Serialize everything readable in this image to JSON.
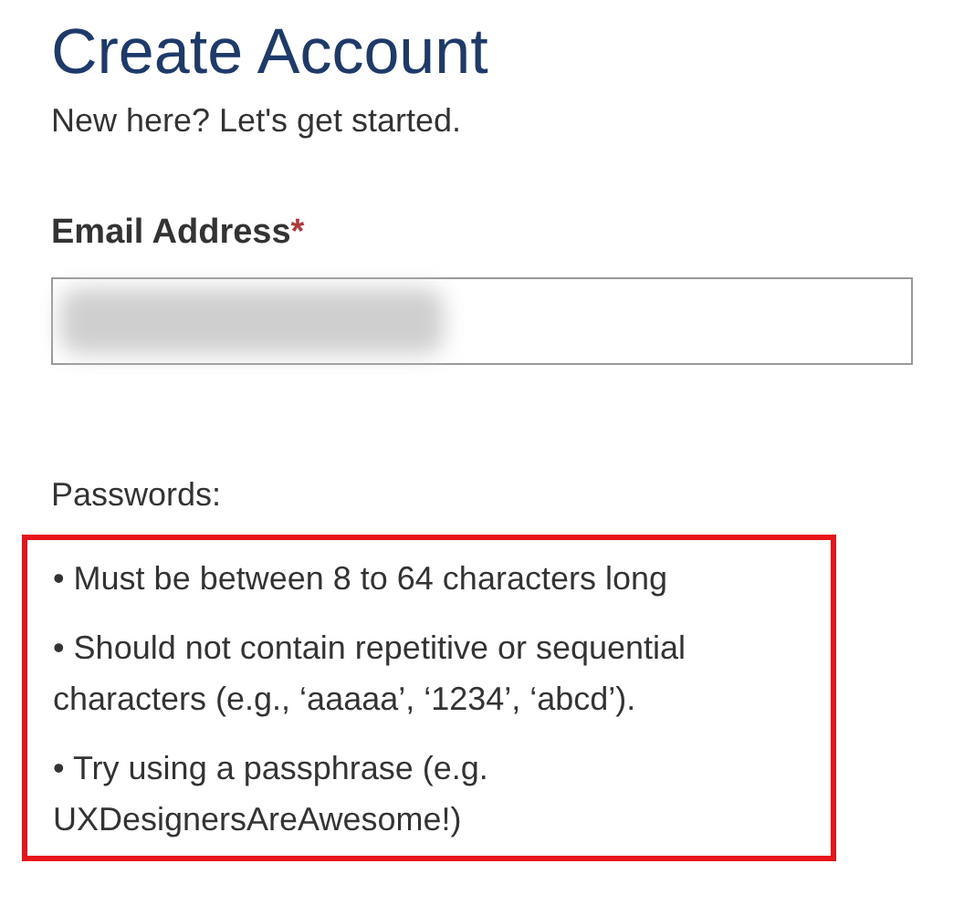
{
  "title": "Create Account",
  "subtitle": "New here? Let's get started.",
  "email": {
    "label": "Email Address",
    "required_mark": "*",
    "value_redacted": true
  },
  "passwords": {
    "heading": "Passwords:",
    "highlighted": true,
    "rules": [
      {
        "text": "• Must be between 8 to 64 characters long"
      },
      {
        "text": "• Should not contain repetitive or sequential characters (e.g., ‘aaaaa’, ‘1234’, ‘abcd’)."
      },
      {
        "text": "• Try using a passphrase (e.g. UXDesignersAreAwesome!)"
      }
    ]
  }
}
